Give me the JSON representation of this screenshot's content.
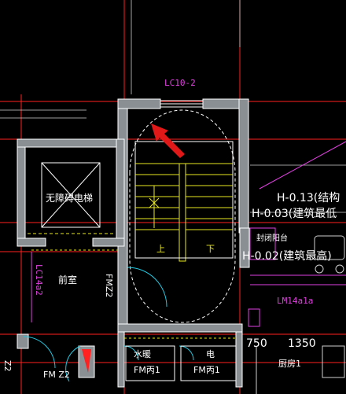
{
  "drawing": {
    "window_tag_top": "LC10-2",
    "elevator_label": "无障碍电梯",
    "window_tag_left": "LC14a2",
    "anteroom_label": "前室",
    "door_fm_z2_right": "FMZ2",
    "door_fm_z2_bottom": "FM Z2",
    "left_edge_tag": "Z2",
    "stair_up_label": "上",
    "stair_down_label": "下",
    "water_shaft_label": "水暖",
    "water_shaft_door": "FM丙1",
    "elec_shaft_label": "电",
    "elec_shaft_door": "FM丙1",
    "elev_note_1": "H-0.13(结构",
    "elev_note_2": "H-0.03(建筑最低",
    "balcony_label": "封闭阳台",
    "elev_note_3": "H-0.02(建筑最高)",
    "door_tag_lm": "LM14a1a",
    "dim_1": "750",
    "dim_2": "1350",
    "kitchen_label": "厨房1"
  },
  "colors": {
    "background": "#000000",
    "wall_fill": "#8a8f93",
    "wall_line": "#ffffff",
    "axis_red": "#ff2020",
    "magenta": "#e040e0",
    "yellow": "#e8e820",
    "cyan": "#20c8e0",
    "arrow": "#e01818"
  },
  "icons": [
    "annotation-arrow-icon",
    "door-swing-icon",
    "elevator-cross-icon"
  ]
}
